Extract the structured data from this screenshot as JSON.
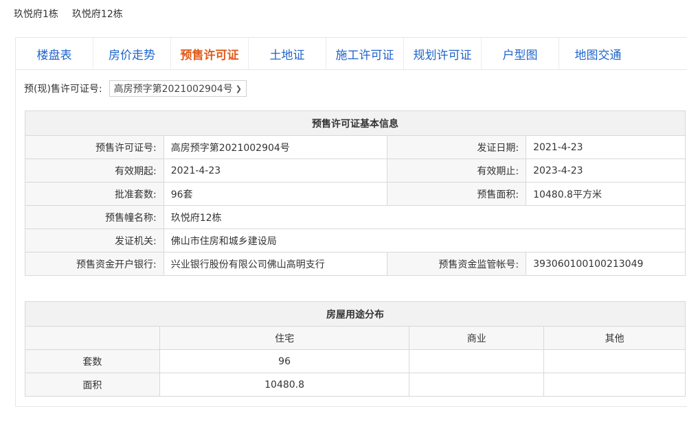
{
  "top_links": [
    "玖悦府1栋",
    "玖悦府12栋"
  ],
  "tabs": [
    "楼盘表",
    "房价走势",
    "预售许可证",
    "土地证",
    "施工许可证",
    "规划许可证",
    "户型图",
    "地图交通"
  ],
  "active_tab_index": 2,
  "license_select": {
    "label": "预(现)售许可证号:",
    "value": "高房预字第2021002904号"
  },
  "basic_info": {
    "title": "预售许可证基本信息",
    "license_no_label": "预售许可证号:",
    "license_no": "高房预字第2021002904号",
    "issue_date_label": "发证日期:",
    "issue_date": "2021-4-23",
    "valid_from_label": "有效期起:",
    "valid_from": "2021-4-23",
    "valid_to_label": "有效期止:",
    "valid_to": "2023-4-23",
    "approved_units_label": "批准套数:",
    "approved_units": "96套",
    "presale_area_label": "预售面积:",
    "presale_area": "10480.8平方米",
    "building_label": "预售幢名称:",
    "building": "玖悦府12栋",
    "authority_label": "发证机关:",
    "authority": "佛山市住房和城乡建设局",
    "bank_label": "预售资金开户银行:",
    "bank": "兴业银行股份有限公司佛山高明支行",
    "account_label": "预售资金监管帐号:",
    "account": "393060100100213049"
  },
  "usage": {
    "title": "房屋用途分布",
    "columns": [
      "住宅",
      "商业",
      "其他"
    ],
    "rows": [
      {
        "label": "套数",
        "values": [
          "96",
          "",
          ""
        ]
      },
      {
        "label": "面积",
        "values": [
          "10480.8",
          "",
          ""
        ]
      }
    ]
  }
}
